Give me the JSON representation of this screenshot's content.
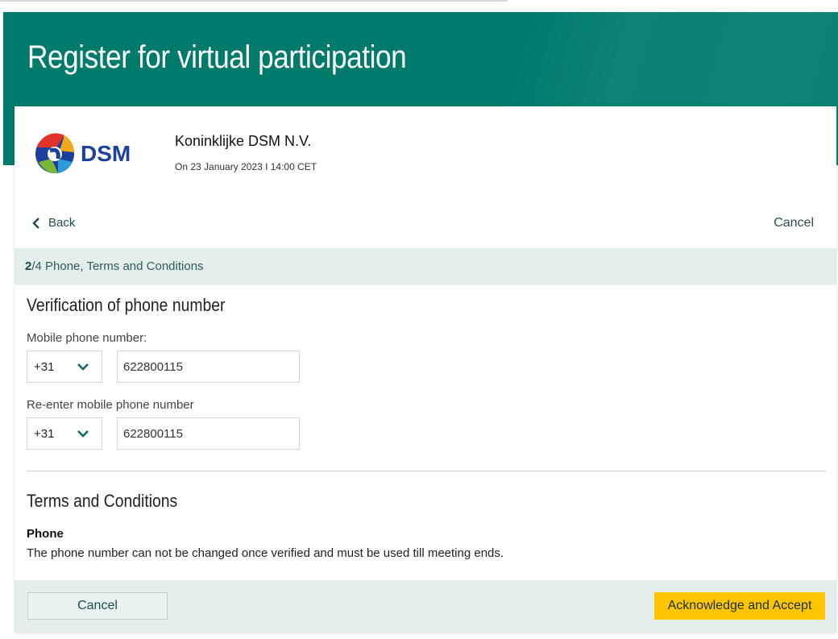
{
  "banner": {
    "title": "Register for virtual participation"
  },
  "event": {
    "logo_text": "DSM",
    "organization": "Koninklijke DSM N.V.",
    "date": "On 23 January 2023 I 14:00 CET"
  },
  "nav": {
    "back_label": "Back",
    "cancel_label": "Cancel"
  },
  "step": {
    "current": "2",
    "rest": "/4 Phone, Terms and Conditions"
  },
  "verification": {
    "title": "Verification of phone number",
    "mobile_label": "Mobile phone number:",
    "mobile_country_code": "+31",
    "mobile_value": "622800115",
    "reenter_label": "Re-enter mobile phone number",
    "reenter_country_code": "+31",
    "reenter_value": "622800115"
  },
  "terms": {
    "title": "Terms and Conditions",
    "phone_heading": "Phone",
    "phone_text": "The phone number can not be changed once verified and must be used till meeting ends."
  },
  "footer": {
    "cancel_label": "Cancel",
    "accept_label": "Acknowledge and Accept"
  },
  "colors": {
    "brand": "#007a6b",
    "accent": "#ffc600",
    "step_bg": "#e3eeed",
    "logo_blue": "#1d3f9e"
  },
  "icons": {
    "back": "chevron-left-icon",
    "dropdown": "chevron-down-icon"
  }
}
